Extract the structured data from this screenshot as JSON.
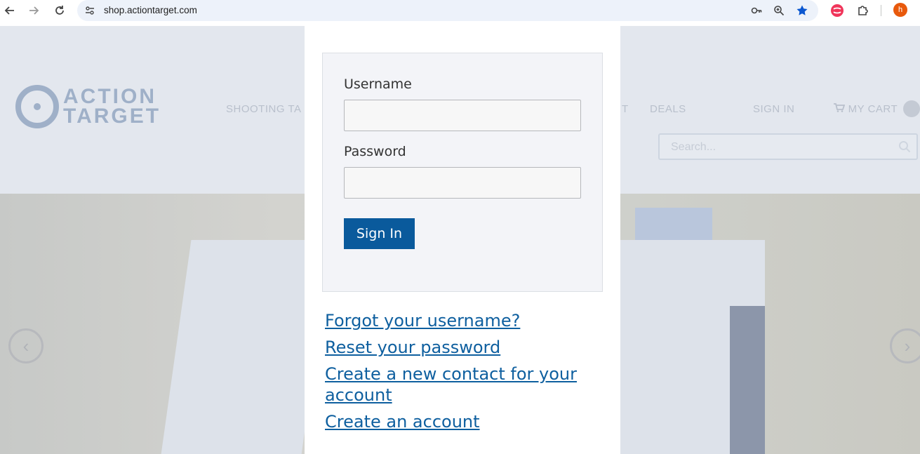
{
  "browser": {
    "url": "shop.actiontarget.com",
    "avatar_letter": "h",
    "icons": {
      "back": "back-arrow-icon",
      "forward": "forward-arrow-icon",
      "reload": "reload-icon",
      "site_info": "site-info-icon",
      "password": "key-icon",
      "zoom": "zoom-icon",
      "bookmark": "star-icon",
      "extension": "extension-icon",
      "extensions_menu": "puzzle-icon"
    },
    "accent": "#0b57d0"
  },
  "site": {
    "logo_line1": "ACTION",
    "logo_line2": "TARGET",
    "nav": [
      "SHOOTING TA",
      "T",
      "DEALS",
      "SIGN IN",
      "MY CART"
    ],
    "search_placeholder": "Search..."
  },
  "login": {
    "username_label": "Username",
    "username_value": "",
    "password_label": "Password",
    "password_value": "",
    "signin_label": "Sign In",
    "links": [
      "Forgot your username?",
      "Reset your password",
      "Create a new contact for your account",
      "Create an account"
    ],
    "colors": {
      "button": "#0a5a9c",
      "link": "#0e5f9f"
    }
  }
}
